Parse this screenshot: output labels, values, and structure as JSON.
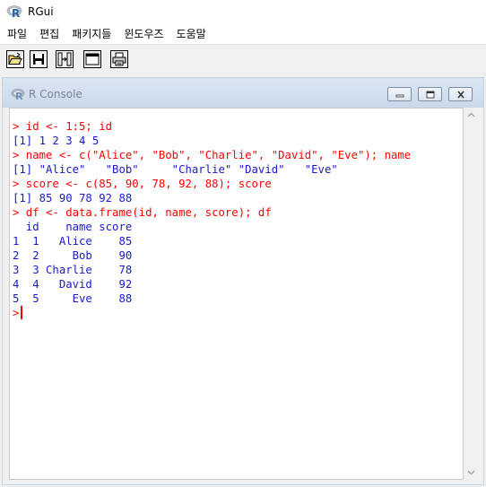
{
  "app": {
    "title": "RGui"
  },
  "menu": [
    "파일",
    "편집",
    "패키지들",
    "윈도우즈",
    "도움말"
  ],
  "toolbar": {
    "buttons": [
      "open-script-icon",
      "save-icon",
      "load-workspace-icon",
      "console-icon",
      "print-icon"
    ]
  },
  "console": {
    "title": "R Console",
    "lines": [
      {
        "kind": "cmd",
        "text": "> id <- 1:5; id"
      },
      {
        "kind": "out",
        "text": "[1] 1 2 3 4 5"
      },
      {
        "kind": "cmd",
        "text": "> name <- c(\"Alice\", \"Bob\", \"Charlie\", \"David\", \"Eve\"); name"
      },
      {
        "kind": "out",
        "text": "[1] \"Alice\"   \"Bob\"     \"Charlie\" \"David\"   \"Eve\""
      },
      {
        "kind": "cmd",
        "text": "> score <- c(85, 90, 78, 92, 88); score"
      },
      {
        "kind": "out",
        "text": "[1] 85 90 78 92 88"
      },
      {
        "kind": "cmd",
        "text": "> df <- data.frame(id, name, score); df"
      },
      {
        "kind": "out",
        "text": "  id    name score"
      },
      {
        "kind": "out",
        "text": "1  1   Alice    85"
      },
      {
        "kind": "out",
        "text": "2  2     Bob    90"
      },
      {
        "kind": "out",
        "text": "3  3 Charlie    78"
      },
      {
        "kind": "out",
        "text": "4  4   David    92"
      },
      {
        "kind": "out",
        "text": "5  5     Eve    88"
      }
    ],
    "prompt": ">"
  },
  "colors": {
    "command": "#ff0000",
    "output": "#1a1ac8"
  }
}
